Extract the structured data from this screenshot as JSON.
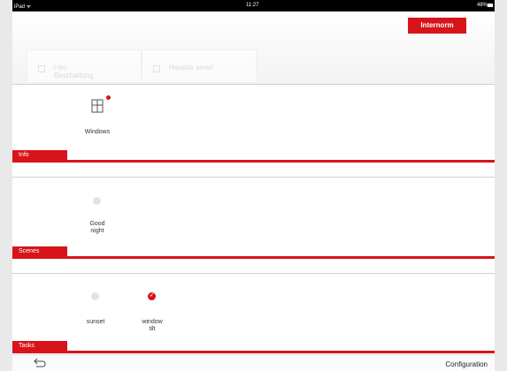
{
  "statusbar": {
    "carrier": "iPad ᯤ",
    "time": "11:27",
    "battery_text": "48%"
  },
  "header": {
    "brand": "Internorm",
    "tabs": [
      {
        "label_line1": "i-tec",
        "label_line2": "Beschattung"
      },
      {
        "label_line1": "Haustür smart",
        "label_line2": ""
      }
    ]
  },
  "sections": {
    "info": {
      "label": "Info",
      "items": [
        {
          "label": "Windows",
          "icon": "window-icon",
          "has_alert": true
        }
      ]
    },
    "scenes": {
      "label": "Scenes",
      "items": [
        {
          "label_line1": "Good",
          "label_line2": "night",
          "icon": "scene-circle-icon",
          "active": false
        }
      ]
    },
    "tasks": {
      "label": "Tasks",
      "items": [
        {
          "label_line1": "sunset",
          "label_line2": "",
          "icon": "task-circle-icon",
          "active": false
        },
        {
          "label_line1": "window",
          "label_line2": "tilt",
          "icon": "check-icon",
          "active": true
        }
      ]
    }
  },
  "bottombar": {
    "back_icon": "back-arrow-icon",
    "config_label": "Configuration"
  },
  "colors": {
    "accent": "#d7141a",
    "frame": "#e9e9e9"
  }
}
